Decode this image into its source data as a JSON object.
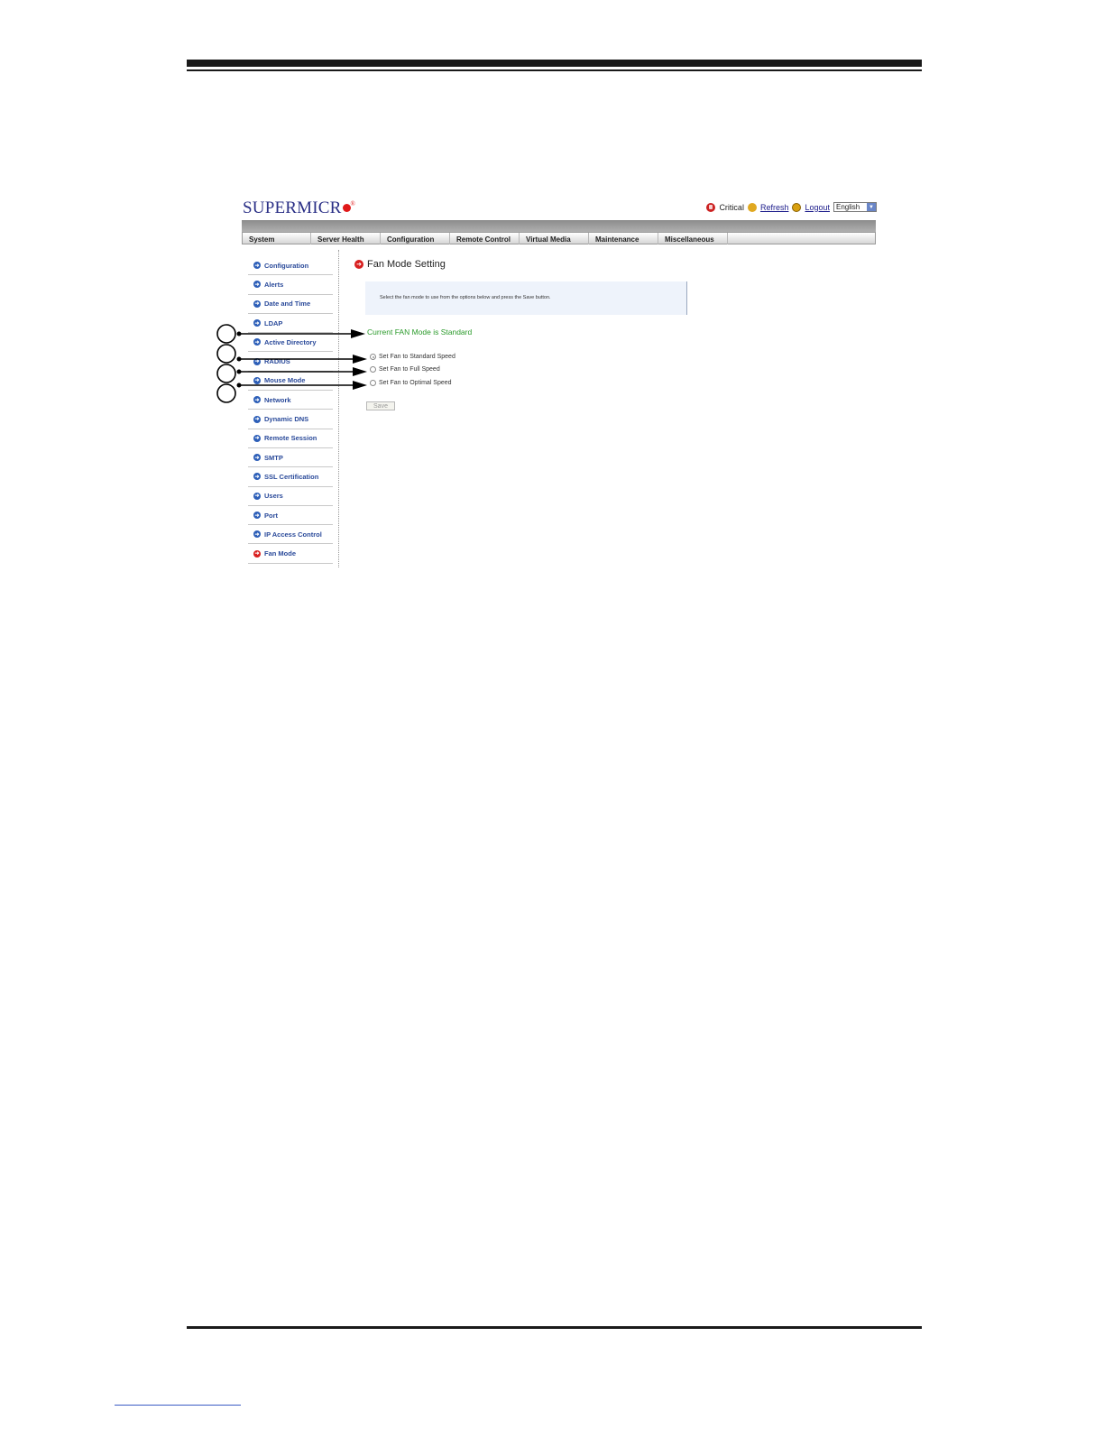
{
  "header": {
    "logo_text": "SUPERMICR",
    "critical_label": "Critical",
    "refresh_label": "Refresh",
    "logout_label": "Logout",
    "language": "English"
  },
  "menu": {
    "items": [
      "System",
      "Server Health",
      "Configuration",
      "Remote Control",
      "Virtual Media",
      "Maintenance",
      "Miscellaneous"
    ]
  },
  "sidebar": {
    "items": [
      {
        "label": "Configuration"
      },
      {
        "label": "Alerts"
      },
      {
        "label": "Date and Time"
      },
      {
        "label": "LDAP"
      },
      {
        "label": "Active Directory"
      },
      {
        "label": "RADIUS"
      },
      {
        "label": "Mouse Mode"
      },
      {
        "label": "Network"
      },
      {
        "label": "Dynamic DNS"
      },
      {
        "label": "Remote Session"
      },
      {
        "label": "SMTP"
      },
      {
        "label": "SSL Certification"
      },
      {
        "label": "Users"
      },
      {
        "label": "Port"
      },
      {
        "label": "IP Access Control"
      },
      {
        "label": "Fan Mode"
      }
    ],
    "active": "Fan Mode"
  },
  "main": {
    "title": "Fan Mode Setting",
    "instructions": "Select the fan mode to use from the options below and press the Save button.",
    "current_mode": "Current FAN Mode is Standard",
    "options": [
      {
        "label": "Set Fan to Standard Speed",
        "checked": true
      },
      {
        "label": "Set Fan to Full Speed",
        "checked": false
      },
      {
        "label": "Set Fan to Optimal Speed",
        "checked": false
      }
    ],
    "save_label": "Save"
  },
  "colors": {
    "brand": "#2a2f86",
    "accent_red": "#e01818",
    "status_green": "#2a9a2a",
    "link_blue": "#2a4a9a"
  }
}
